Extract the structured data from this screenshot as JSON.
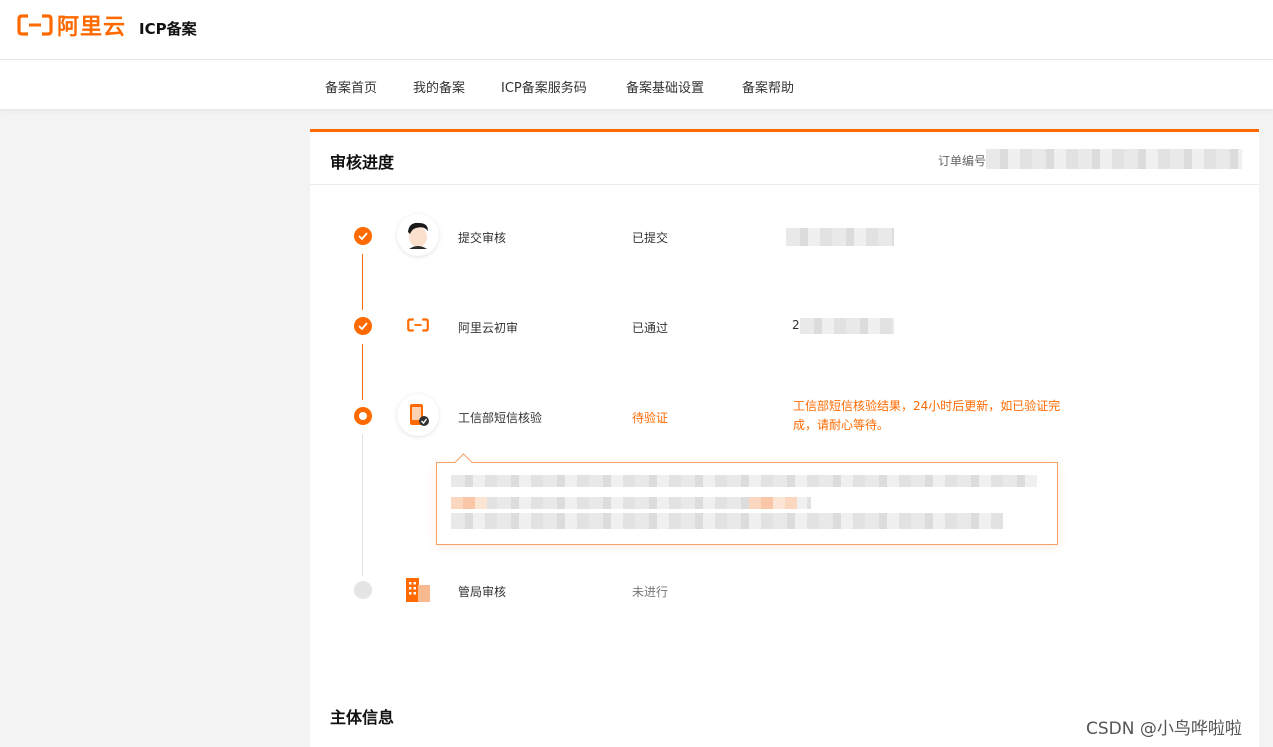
{
  "header": {
    "logo_text": "阿里云",
    "product_name": "ICP备案"
  },
  "nav": {
    "items": [
      "备案首页",
      "我的备案",
      "ICP备案服务码",
      "备案基础设置",
      "备案帮助"
    ]
  },
  "card": {
    "title": "审核进度",
    "order_label": "订单编号"
  },
  "steps": [
    {
      "name": "提交审核",
      "status": "已提交",
      "icon": "user-avatar-icon",
      "state": "done"
    },
    {
      "name": "阿里云初审",
      "status": "已通过",
      "value_prefix": "2",
      "icon": "aliyun-logo-icon",
      "state": "done"
    },
    {
      "name": "工信部短信核验",
      "status": "待验证",
      "icon": "phone-verify-icon",
      "state": "current",
      "note": "工信部短信核验结果，24小时后更新，如已验证完成，请耐心等待。"
    },
    {
      "name": "管局审核",
      "status": "未进行",
      "icon": "building-icon",
      "state": "pending"
    }
  ],
  "section2": {
    "title": "主体信息"
  },
  "watermark": "CSDN @小鸟哗啦啦",
  "colors": {
    "accent": "#ff6a00",
    "background": "#f3f3f3"
  }
}
